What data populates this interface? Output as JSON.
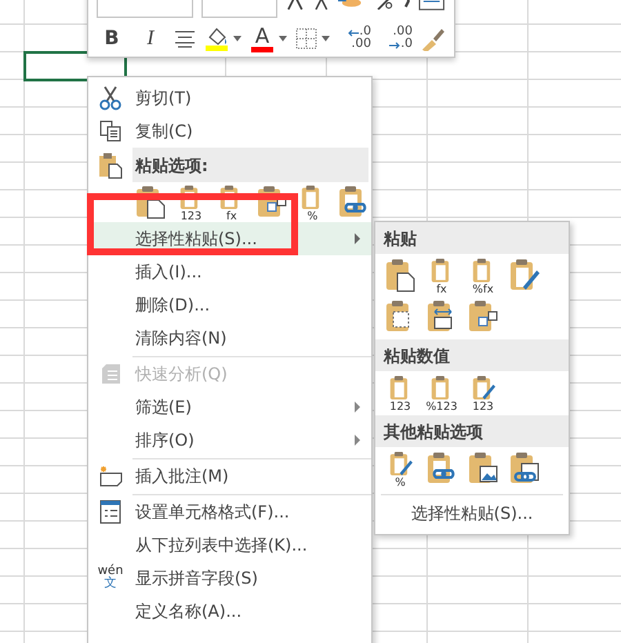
{
  "toolbar": {
    "top_row": [
      {
        "kind": "font-field"
      },
      {
        "kind": "size-field"
      },
      {
        "kind": "grow"
      },
      {
        "kind": "shrink"
      },
      {
        "kind": "accounting"
      },
      {
        "kind": "percent"
      },
      {
        "kind": "comma"
      },
      {
        "kind": "table"
      }
    ],
    "bottom_row": [
      {
        "kind": "bold",
        "label": "B"
      },
      {
        "kind": "italic",
        "label": "I"
      },
      {
        "kind": "align"
      },
      {
        "kind": "fill",
        "color": "#ffff00"
      },
      {
        "kind": "font-color",
        "label": "A",
        "color": "#ff0000"
      },
      {
        "kind": "border"
      },
      {
        "kind": "increase-decimal",
        "label": ".0",
        "label2": ".00"
      },
      {
        "kind": "decrease-decimal",
        "label": ".00",
        "label2": ".0"
      },
      {
        "kind": "painter"
      }
    ]
  },
  "context_menu": {
    "items": [
      {
        "kind": "item",
        "label": "剪切(T)",
        "disabled": false,
        "selected": false,
        "submenu": false
      },
      {
        "kind": "item",
        "label": "复制(C)",
        "disabled": false,
        "selected": false,
        "submenu": false
      },
      {
        "kind": "header",
        "label": "粘贴选项:"
      },
      {
        "kind": "icons",
        "icons": [
          {
            "kind": "paste"
          },
          {
            "kind": "values",
            "label": "123"
          },
          {
            "kind": "formula",
            "label": "fx"
          },
          {
            "kind": "transpose"
          },
          {
            "kind": "format",
            "label": "%"
          },
          {
            "kind": "link"
          }
        ]
      },
      {
        "kind": "item",
        "label": "选择性粘贴(S)...",
        "disabled": false,
        "selected": true,
        "submenu": true
      },
      {
        "kind": "item",
        "label": "插入(I)...",
        "disabled": false,
        "selected": false,
        "submenu": false
      },
      {
        "kind": "item",
        "label": "删除(D)...",
        "disabled": false,
        "selected": false,
        "submenu": false
      },
      {
        "kind": "item",
        "label": "清除内容(N)",
        "disabled": false,
        "selected": false,
        "submenu": false
      },
      {
        "kind": "separator"
      },
      {
        "kind": "item",
        "label": "快速分析(Q)",
        "disabled": true,
        "selected": false,
        "submenu": false
      },
      {
        "kind": "item",
        "label": "筛选(E)",
        "disabled": false,
        "selected": false,
        "submenu": true
      },
      {
        "kind": "item",
        "label": "排序(O)",
        "disabled": false,
        "selected": false,
        "submenu": true
      },
      {
        "kind": "separator"
      },
      {
        "kind": "item",
        "label": "插入批注(M)",
        "disabled": false,
        "selected": false,
        "submenu": false
      },
      {
        "kind": "separator"
      },
      {
        "kind": "item",
        "label": "设置单元格格式(F)...",
        "disabled": false,
        "selected": false,
        "submenu": false
      },
      {
        "kind": "item",
        "label": "从下拉列表中选择(K)...",
        "disabled": false,
        "selected": false,
        "submenu": false
      },
      {
        "kind": "item",
        "icon_label": "wén",
        "icon_label2": "文",
        "label": "显示拼音字段(S)",
        "disabled": false,
        "selected": false,
        "submenu": false
      },
      {
        "kind": "item",
        "label": "定义名称(A)...",
        "disabled": false,
        "selected": false,
        "submenu": false
      }
    ]
  },
  "submenu": {
    "sections": [
      {
        "title": "粘贴",
        "icons": [
          {
            "kind": "paste"
          },
          {
            "kind": "formula",
            "label": "fx"
          },
          {
            "kind": "format",
            "label": "%fx"
          },
          {
            "kind": "brush"
          },
          {
            "kind": "noborder"
          },
          {
            "kind": "width"
          },
          {
            "kind": "transpose"
          }
        ]
      },
      {
        "title": "粘贴数值",
        "icons": [
          {
            "kind": "values",
            "label": "123"
          },
          {
            "kind": "format",
            "label": "%123"
          },
          {
            "kind": "brush",
            "label": "123"
          }
        ]
      },
      {
        "title": "其他粘贴选项",
        "icons": [
          {
            "kind": "brush",
            "label": "%"
          },
          {
            "kind": "link"
          },
          {
            "kind": "picture"
          },
          {
            "kind": "linkpicture"
          }
        ]
      }
    ],
    "footer": "选择性粘贴(S)..."
  },
  "annotation": {
    "kind": "frame",
    "color": "#ff3333"
  }
}
